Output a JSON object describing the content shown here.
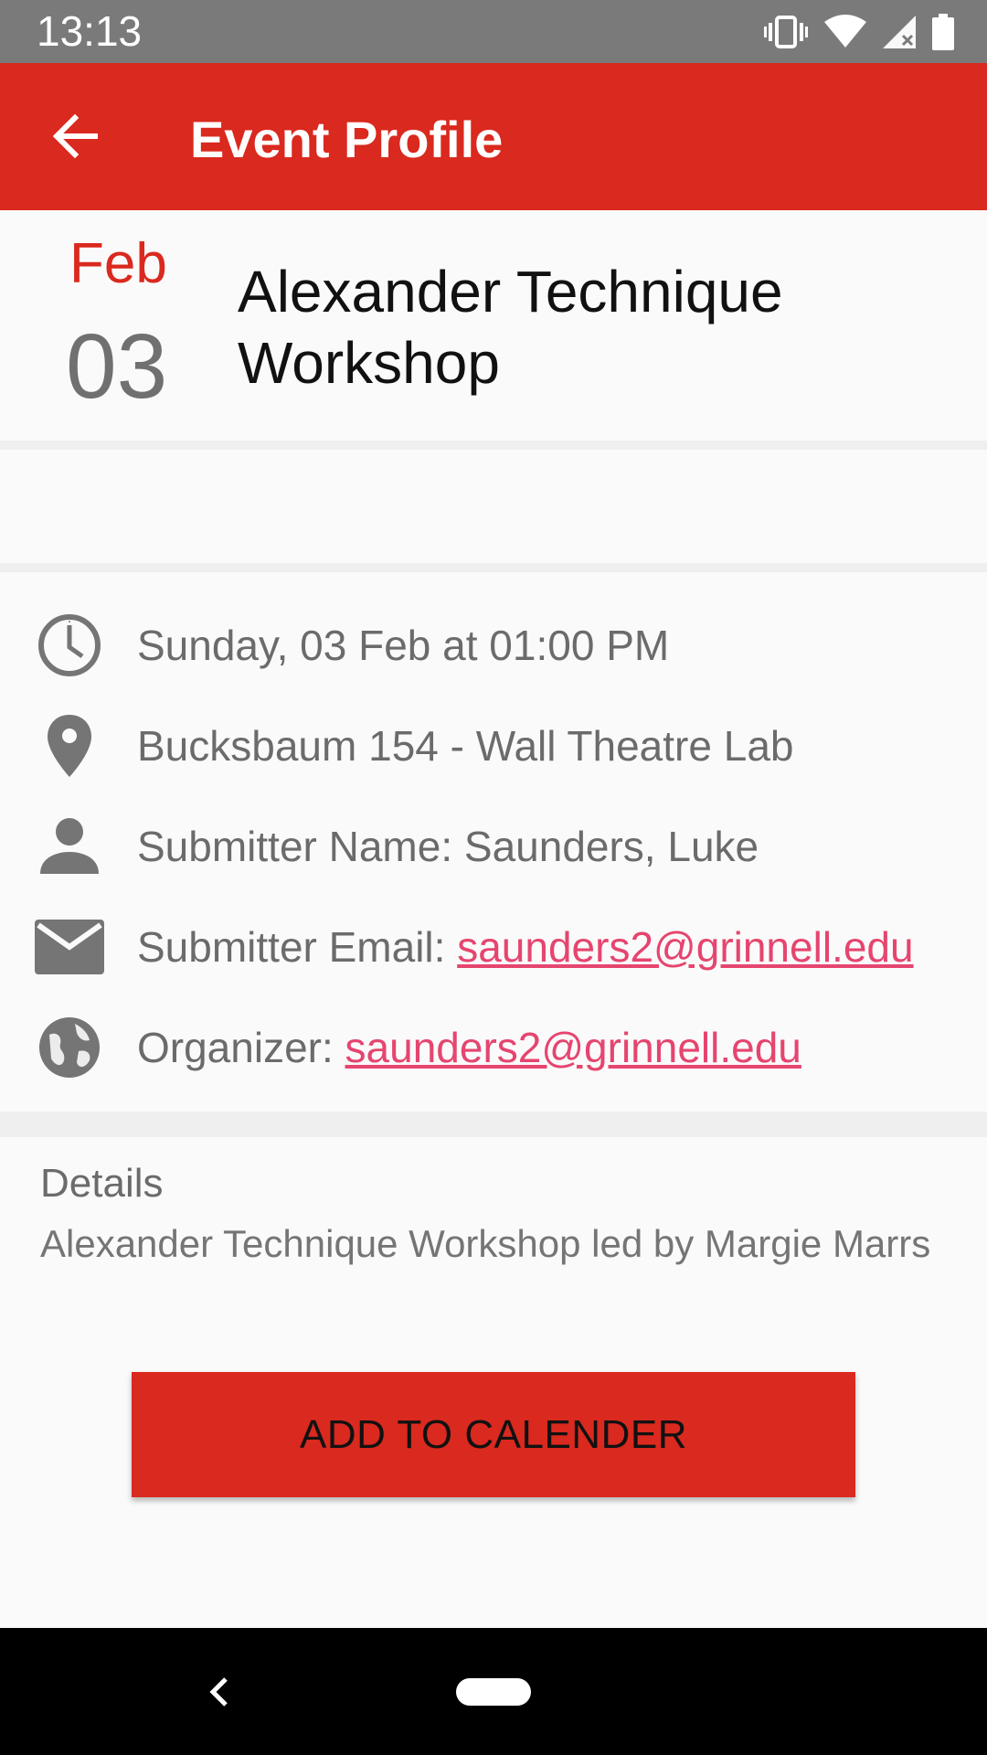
{
  "status_bar": {
    "time": "13:13",
    "icons": [
      "vibrate-icon",
      "wifi-icon",
      "signal-icon",
      "battery-icon"
    ]
  },
  "app_bar": {
    "title": "Event Profile",
    "back_icon": "arrow-back-icon",
    "color": "#da291e"
  },
  "event": {
    "month": "Feb",
    "day": "03",
    "title": "Alexander Technique Workshop"
  },
  "info": {
    "datetime": "Sunday, 03 Feb at 01:00 PM",
    "location": "Bucksbaum 154 - Wall Theatre Lab",
    "submitter_name": "Submitter Name: Saunders, Luke",
    "submitter_email_label": "Submitter Email: ",
    "submitter_email": "saunders2@grinnell.edu",
    "organizer_label": "Organizer: ",
    "organizer_email": "saunders2@grinnell.edu"
  },
  "details": {
    "heading": "Details",
    "body": "Alexander Technique Workshop led by Margie Marrs"
  },
  "actions": {
    "add_to_calendar": "ADD TO CALENDER"
  },
  "colors": {
    "accent": "#da291e",
    "link": "#e5456f",
    "secondary_text": "#6b6b6b"
  }
}
